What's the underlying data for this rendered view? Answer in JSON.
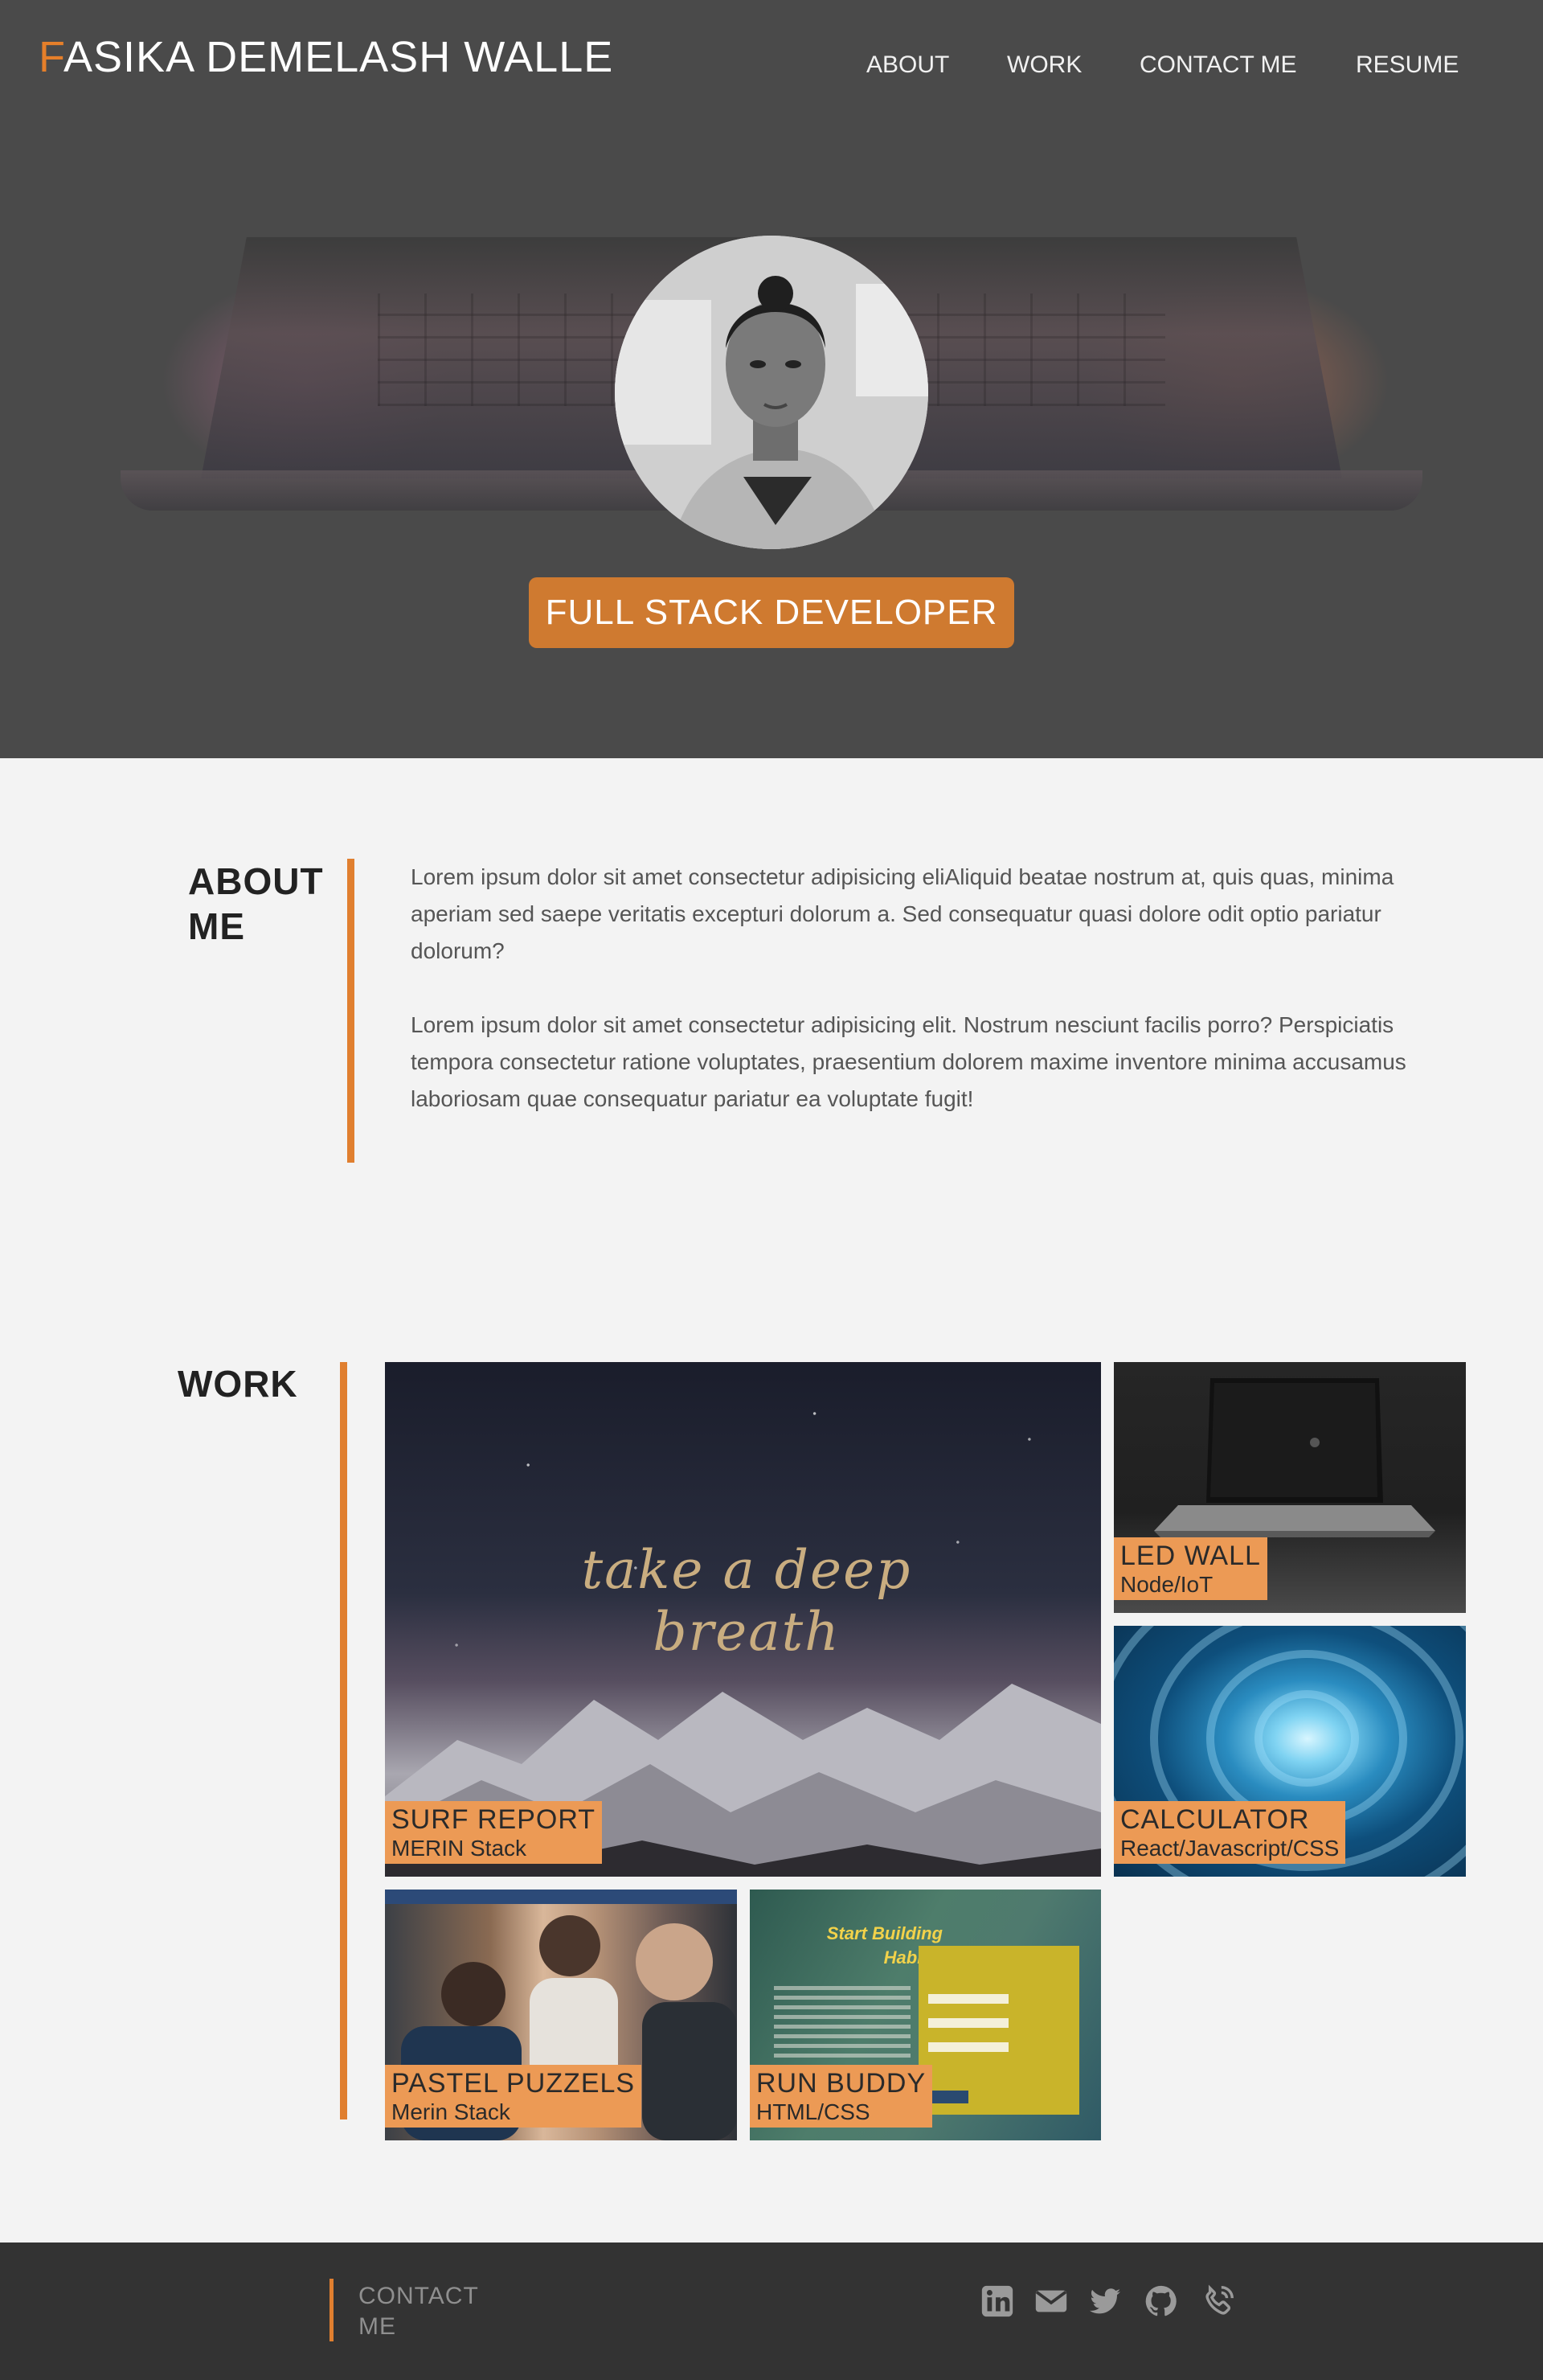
{
  "header": {
    "logo_initial": "F",
    "logo_rest": "ASIKA DEMELASH WALLE",
    "nav": {
      "about": "ABOUT",
      "work": "WORK",
      "contact": "CONTACT ME",
      "resume": "RESUME"
    },
    "role": "FULL STACK DEVELOPER"
  },
  "about": {
    "title": "ABOUT ME",
    "paragraphs": [
      "Lorem ipsum dolor sit amet consectetur adipisicing eliAliquid beatae nostrum at, quis quas, minima aperiam sed saepe veritatis excepturi dolorum a. Sed consequatur quasi dolore odit optio pariatur dolorum?",
      "Lorem ipsum dolor sit amet consectetur adipisicing elit. Nostrum nesciunt facilis porro? Perspiciatis tempora consectetur ratione voluptates, praesentium dolorem maxime inventore minima accusamus laboriosam quae consequatur pariatur ea voluptate fugit!"
    ]
  },
  "work": {
    "title": "WORK",
    "projects": [
      {
        "title": "SURF REPORT",
        "stack": "MERIN Stack",
        "image_text": "take a deep breath"
      },
      {
        "title": "LED WALL",
        "stack": "Node/IoT"
      },
      {
        "title": "CALCULATOR",
        "stack": "React/Javascript/CSS"
      },
      {
        "title": "PASTEL PUZZELS",
        "stack": "Merin Stack"
      },
      {
        "title": "RUN BUDDY",
        "stack": "HTML/CSS",
        "image_text_1": "Start Building",
        "image_text_2": "Habits."
      }
    ]
  },
  "footer": {
    "title": "CONTACT ME",
    "icons": [
      "linkedin-icon",
      "email-icon",
      "twitter-icon",
      "github-icon",
      "phone-icon"
    ]
  },
  "colors": {
    "accent": "#e07f2f",
    "badge": "#cf7a30",
    "caption": "#ec9a55",
    "hero_bg": "#4a4a4a",
    "footer_bg": "#333333"
  }
}
